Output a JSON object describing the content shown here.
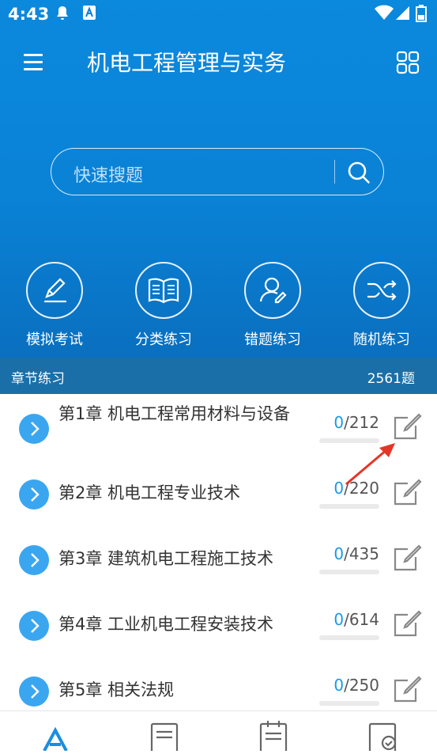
{
  "status_bar": {
    "time": "4:43"
  },
  "header": {
    "title": "机电工程管理与实务"
  },
  "search": {
    "placeholder": "快速搜题"
  },
  "quick_actions": [
    {
      "label": "模拟考试",
      "icon": "pen-icon"
    },
    {
      "label": "分类练习",
      "icon": "book-icon"
    },
    {
      "label": "错题练习",
      "icon": "user-edit-icon"
    },
    {
      "label": "随机练习",
      "icon": "shuffle-icon"
    }
  ],
  "section": {
    "title": "章节练习",
    "total": "2561题"
  },
  "chapters": [
    {
      "title": "第1章 机电工程常用材料与设备",
      "done": "0",
      "total": "/212"
    },
    {
      "title": "第2章 机电工程专业技术",
      "done": "0",
      "total": "/220"
    },
    {
      "title": "第3章 建筑机电工程施工技术",
      "done": "0",
      "total": "/435"
    },
    {
      "title": "第4章 工业机电工程安装技术",
      "done": "0",
      "total": "/614"
    },
    {
      "title": "第5章 相关法规",
      "done": "0",
      "total": "/250"
    }
  ],
  "colors": {
    "primary": "#0a82d6",
    "accent": "#1a9ae9",
    "arrow": "#3aa6ef"
  }
}
